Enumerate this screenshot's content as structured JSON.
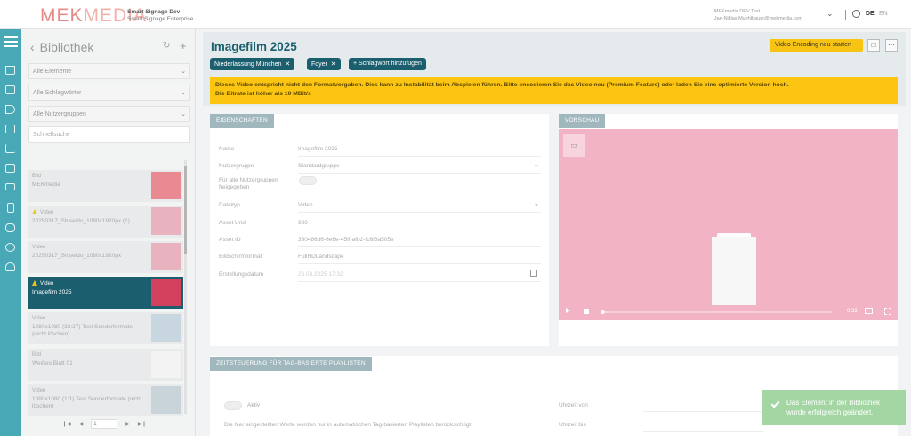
{
  "header": {
    "logo_a": "MEK",
    "logo_b": "MEDIA",
    "org_name": "Smart Signage Dev",
    "org_sub": "Smart Signage Enterprise",
    "user_line1": "MEKmedia DEV Test",
    "user_line2": "Jan-Niklas.Muehlbauer@mekmedia.com",
    "lang_active": "DE",
    "lang_other": "EN"
  },
  "library": {
    "title": "Bibliothek",
    "filters": [
      "Alle Elemente",
      "Alle Schlagwörter",
      "Alle Nutzergruppen"
    ],
    "search_placeholder": "Schnellsuche",
    "items": [
      {
        "type": "Bild",
        "name": "MEKmedia",
        "warn": false,
        "thumb": "#e98a92"
      },
      {
        "type": "Video",
        "name": "20250317_Shiseido_1080x1920px (1)",
        "warn": true,
        "thumb": "#e8b3bf"
      },
      {
        "type": "Video",
        "name": "20250317_Shiseido_1080x1920px",
        "warn": false,
        "thumb": "#e8b3bf"
      },
      {
        "type": "Video",
        "name": "Imagefilm 2025",
        "warn": true,
        "thumb": "#d4415f"
      },
      {
        "type": "Video",
        "name": "1280x1080 (32:27) Test Sonderformate (nicht löschen)",
        "warn": false,
        "thumb": "#c8d6e0"
      },
      {
        "type": "Bild",
        "name": "Weißes Blatt 01",
        "warn": false,
        "thumb": "#f3f3f3"
      },
      {
        "type": "Video",
        "name": "1080x1080 (1:1) Test Sonderformate (nicht löschen)",
        "warn": false,
        "thumb": "#c9d3da"
      }
    ],
    "page": "1"
  },
  "detail": {
    "title": "Imagefilm 2025",
    "tags": [
      "Niederlassung München",
      "Foyer"
    ],
    "add_tag": "+ Schlagwort hinzufügen",
    "encode_btn": "Video Encoding neu starten",
    "alert_line1": "Dieses Video entspricht nicht den Formatvorgaben. Dies kann zu Instabilität beim Abspielen führen. Bitte encodieren Sie das Video neu (Premium Feature) oder laden Sie eine optimierte Version hoch.",
    "alert_line2": "Die Bitrate ist höher als 10 MBit/s"
  },
  "props": {
    "heading": "EIGENSCHAFTEN",
    "rows": [
      {
        "label": "Name",
        "value": "Imagefilm 2025"
      },
      {
        "label": "Nutzergruppe",
        "value": "Standardgruppe"
      },
      {
        "label": "Für alle Nutzergruppen freigegeben",
        "value": ""
      },
      {
        "label": "Dateityp",
        "value": "Video"
      },
      {
        "label": "Asset Urid",
        "value": "936"
      },
      {
        "label": "Asset ID",
        "value": "330486d6-6e6e-45ff-afb2-fc6f3a505e"
      },
      {
        "label": "Bildschirmformat",
        "value": "FullHDLandscape"
      },
      {
        "label": "Erstellungsdatum",
        "value": "26.03.2025 17:32"
      }
    ]
  },
  "preview": {
    "heading": "VORSCHAU",
    "time": "-0:23"
  },
  "schedule": {
    "heading": "ZEITSTEUERUNG FÜR TAG-BASIERTE PLAYLISTEN",
    "active_label": "Aktiv",
    "note": "Die hier eingestellten Werte werden nur in automatischen Tag-basierten Playlisten berücksichtigt",
    "time_from": "Uhrzeit von",
    "time_to": "Uhrzeit bis"
  },
  "toast": {
    "line1": "Das Element in der Bibliothek",
    "line2": "wurde erfolgreich geändert."
  },
  "colors": {
    "accent": "#1b5e6e",
    "sidebar": "#49a8b5",
    "warning": "#fbc512",
    "success": "#a3d6a3"
  }
}
